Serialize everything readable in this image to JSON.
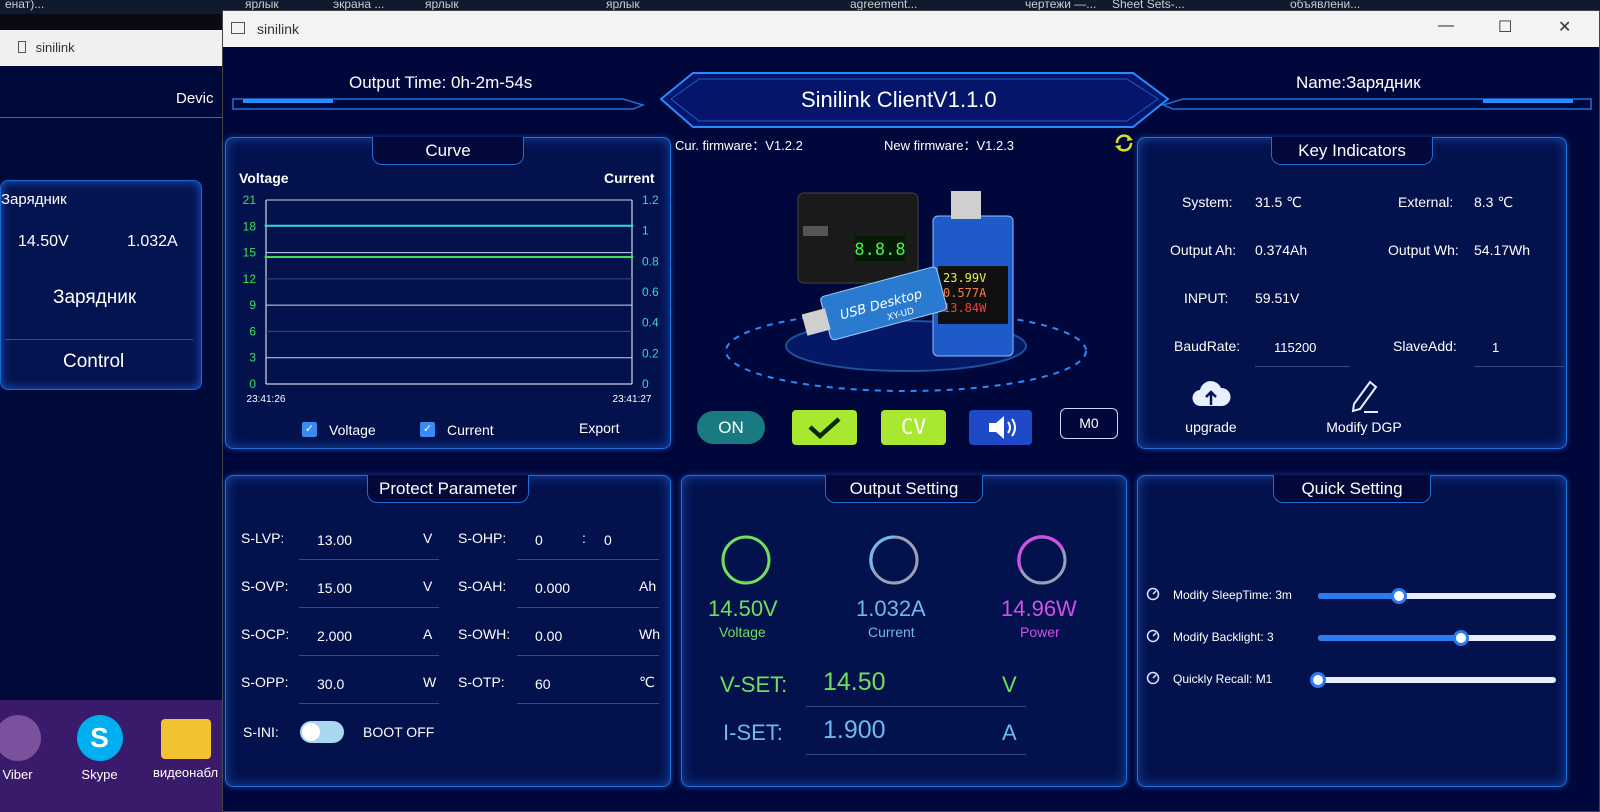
{
  "desktop": {
    "top_labels": [
      "енат)...",
      "ярлык",
      "экрана ...",
      "ярлык",
      "ярлык",
      "agreement...",
      "чертежи —...",
      "Sheet Sets-...",
      "объявлени..."
    ],
    "icons": [
      {
        "label": "Viber",
        "color": "#7b519d"
      },
      {
        "label": "Skype",
        "color": "#00aff0"
      },
      {
        "label": "видеонабл",
        "color": "#f2c230"
      }
    ]
  },
  "back_window": {
    "title": "sinilink",
    "device_label": "Devic",
    "name": "Зарядник",
    "voltage": "14.50V",
    "current": "1.032A",
    "name_large": "Зарядник",
    "control": "Control"
  },
  "window": {
    "title": "sinilink",
    "controls": {
      "minimize": "—",
      "maximize": "☐",
      "close": "✕"
    }
  },
  "header": {
    "output_time": "Output Time: 0h-2m-54s",
    "app_title": "Sinilink ClientV1.1.0",
    "name": "Name:Зарядник",
    "cur_firmware": "Cur. firmware：V1.2.2",
    "new_firmware": "New firmware：V1.2.3"
  },
  "curve": {
    "title": "Curve",
    "voltage_label": "Voltage",
    "current_label": "Current",
    "voltage_check": "Voltage",
    "current_check": "Current",
    "export": "Export"
  },
  "chart_data": {
    "type": "line",
    "title": "Curve",
    "xlabel": "",
    "ylabel": "Voltage",
    "y2label": "Current",
    "x": [
      "23:41:26",
      "23:41:27"
    ],
    "yticks": [
      "0",
      "3",
      "6",
      "9",
      "12",
      "15",
      "18",
      "21"
    ],
    "y2ticks": [
      "0",
      "0.2",
      "0.4",
      "0.6",
      "0.8",
      "1",
      "1.2"
    ],
    "ylim": [
      0,
      21
    ],
    "y2lim": [
      0,
      1.2
    ],
    "grid": true,
    "series": [
      {
        "name": "Voltage",
        "axis": "left",
        "values": [
          14.5,
          14.5
        ],
        "color": "#3de05a"
      },
      {
        "name": "Current",
        "axis": "right",
        "values": [
          1.032,
          1.032
        ],
        "color": "#3ad3e0"
      }
    ]
  },
  "key_indicators": {
    "title": "Key Indicators",
    "system_label": "System:",
    "system_value": "31.5 ℃",
    "external_label": "External:",
    "external_value": "8.3 ℃",
    "ah_label": "Output Ah:",
    "ah_value": "0.374Ah",
    "wh_label": "Output Wh:",
    "wh_value": "54.17Wh",
    "input_label": "INPUT:",
    "input_value": "59.51V",
    "baud_label": "BaudRate:",
    "baud_value": "115200",
    "slave_label": "SlaveAdd:",
    "slave_value": "1",
    "upgrade": "upgrade",
    "modify_dgp": "Modify DGP"
  },
  "device_image": {
    "display_top": "8.8.8",
    "screen_lines": [
      "23.99V",
      "0.577A",
      "13.84W"
    ],
    "usb_text": "USB Desktop",
    "model": "XY-UD"
  },
  "control_buttons": {
    "on": "ON",
    "cv": "CV",
    "m0": "M0"
  },
  "protect": {
    "title": "Protect Parameter",
    "rows": [
      {
        "l1": "S-LVP:",
        "v1": "13.00",
        "u1": "V",
        "l2": "S-OHP:",
        "v2a": "0",
        "sep": ":",
        "v2b": "0",
        "u2": ""
      },
      {
        "l1": "S-OVP:",
        "v1": "15.00",
        "u1": "V",
        "l2": "S-OAH:",
        "v2a": "0.000",
        "sep": "",
        "v2b": "",
        "u2": "Ah"
      },
      {
        "l1": "S-OCP:",
        "v1": "2.000",
        "u1": "A",
        "l2": "S-OWH:",
        "v2a": "0.00",
        "sep": "",
        "v2b": "",
        "u2": "Wh"
      },
      {
        "l1": "S-OPP:",
        "v1": "30.0",
        "u1": "W",
        "l2": "S-OTP:",
        "v2a": "60",
        "sep": "",
        "v2b": "",
        "u2": "℃"
      }
    ],
    "sini_label": "S-INI:",
    "boot_label": "BOOT OFF"
  },
  "output": {
    "title": "Output Setting",
    "voltage_value": "14.50V",
    "voltage_label": "Voltage",
    "current_value": "1.032A",
    "current_label": "Current",
    "power_value": "14.96W",
    "power_label": "Power",
    "vset_label": "V-SET:",
    "vset_value": "14.50",
    "vset_unit": "V",
    "iset_label": "I-SET:",
    "iset_value": "1.900",
    "iset_unit": "A",
    "colors": {
      "voltage": "#6ee05a",
      "current": "#6fb8f0",
      "power": "#d050e8"
    }
  },
  "quick": {
    "title": "Quick Setting",
    "sleep_label": "Modify SleepTime: 3m",
    "sleep_level": 0.34,
    "backlight_label": "Modify Backlight: 3",
    "backlight_level": 0.6,
    "recall_label": "Quickly Recall: M1",
    "recall_level": 0.0
  }
}
